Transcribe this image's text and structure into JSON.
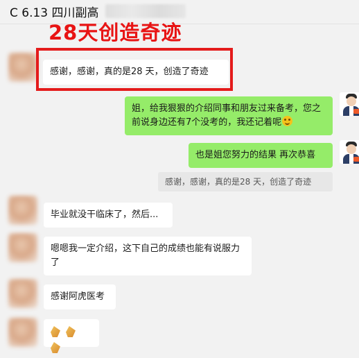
{
  "header": {
    "title": "C 6.13 四川副高"
  },
  "overlay": {
    "title": "28天创造奇迹"
  },
  "messages": {
    "m1": "感谢，感谢，真的是28 天，创造了奇迹",
    "m2": "姐，给我狠狠的介绍同事和朋友过来备考，您之前说身边还有7个没考的，我还记着呢",
    "m3": "也是姐您努力的结果 再次恭喜",
    "quote": "感谢，感谢，真的是28 天，创造了奇迹",
    "m4": "毕业就没干临床了，然后...",
    "m5": "嗯嗯我一定介绍，这下自己的成绩也能有说服力了",
    "m6": "感谢阿虎医考"
  },
  "colors": {
    "accent_red": "#e81414",
    "bubble_green": "#95ec69",
    "background": "#f2f2f2"
  }
}
